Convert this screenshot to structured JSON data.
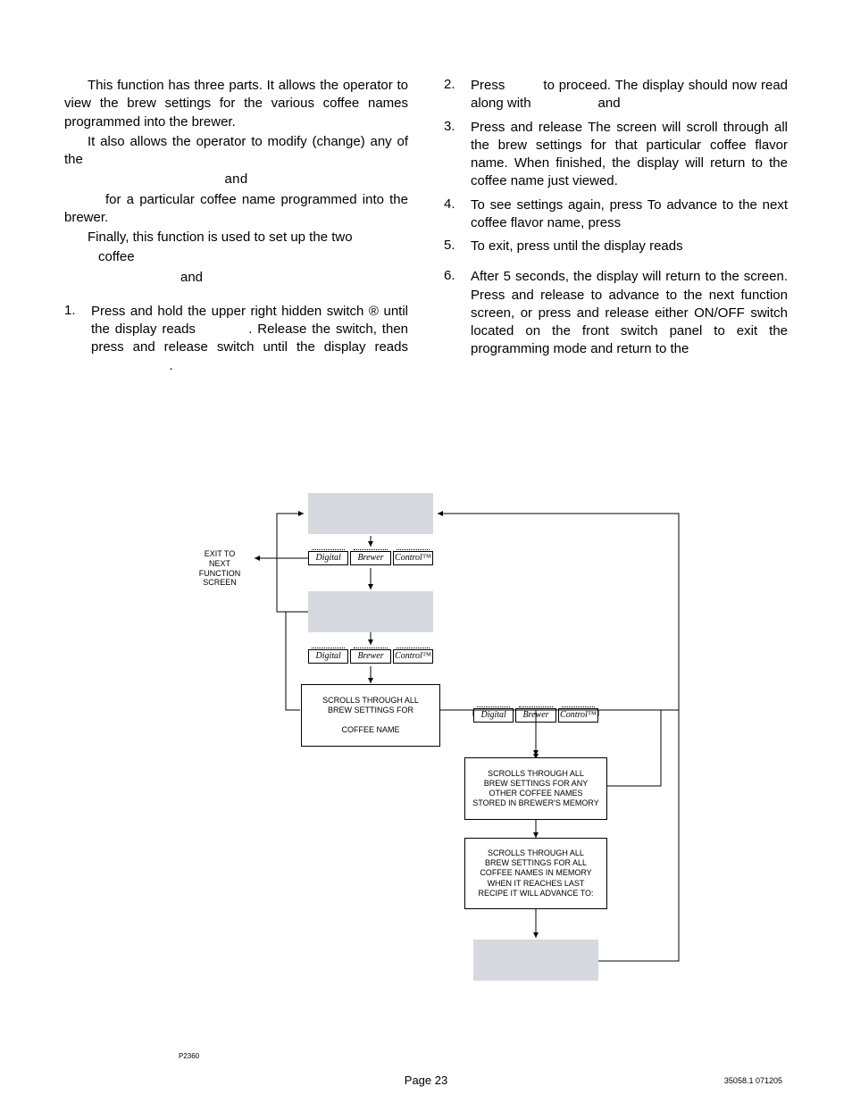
{
  "left": {
    "p1": "This function has three parts. It allows the operator to view the brew settings for the various coffee names programmed into the brewer.",
    "p2": "It also allows the operator to modify (change) any of the",
    "and1": "and",
    "p3": "for a particular coffee name programmed into the brewer.",
    "p4": "Finally, this function is used to set up the two",
    "p4b": "coffee",
    "and2": "and",
    "li1_pre": "Press and hold the upper right hidden switch ",
    "li1_circ": "®",
    "li1_mid": " until the display reads ",
    "li1_mid2": ". Release the switch, then press and release switch until the display reads ",
    "li1_end": "."
  },
  "right": {
    "li2": "Press         to proceed. The display should now read                          along with                  and",
    "li3": "Press and release               The screen will scroll through all the brew settings for that particular coffee flavor name. When finished, the display will return to the coffee name just viewed.",
    "li4": "To see settings again, press             To advance to the next coffee flavor name, press",
    "li5": "To exit, press            until the display reads",
    "li6": "After 5 seconds, the display will return to the                        screen. Press and release         to advance to the next function screen, or press and release either ON/OFF switch located on the front switch panel to exit the programming mode and return to the"
  },
  "diagram": {
    "exit": "EXIT TO\nNEXT FUNCTION\nSCREEN",
    "dbc": {
      "a": "Digital",
      "b": "Brewer",
      "c": "Control™"
    },
    "t1": "SCROLLS THROUGH ALL\nBREW SETTINGS FOR\n\nCOFFEE NAME",
    "t2": "SCROLLS THROUGH ALL\nBREW SETTINGS FOR ANY\nOTHER COFFEE NAMES\nSTORED IN BREWER'S MEMORY",
    "t3": "SCROLLS THROUGH ALL\nBREW SETTINGS FOR ALL\nCOFFEE NAMES IN MEMORY\nWHEN IT REACHES LAST\nRECIPE IT WILL ADVANCE TO:",
    "pnum": "P2360"
  },
  "footer": {
    "page": "Page 23",
    "doc": "35058.1 071205"
  }
}
